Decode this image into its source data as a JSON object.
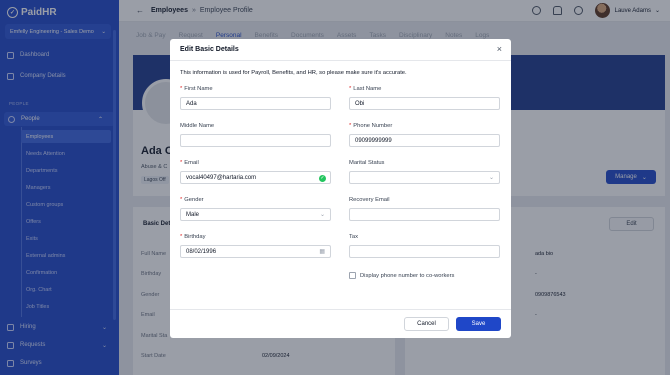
{
  "app": {
    "logo": "PaidHR",
    "org": "Emfelly Engineering - Sales Demo"
  },
  "sidebar": {
    "items": [
      {
        "label": "Dashboard"
      },
      {
        "label": "Company Details"
      }
    ],
    "section_label": "PEOPLE",
    "people_label": "People",
    "people_sub": [
      "Employees",
      "Needs Attention",
      "Departments",
      "Managers",
      "Custom groups",
      "Offers",
      "Exits",
      "External admins",
      "Confirmation",
      "Org. Chart",
      "Job Titles"
    ],
    "bottom": [
      {
        "label": "Hiring"
      },
      {
        "label": "Requests"
      },
      {
        "label": "Surveys"
      }
    ]
  },
  "topbar": {
    "breadcrumb_root": "Employees",
    "breadcrumb_current": "Employee Profile",
    "user_name": "Lauve Adams"
  },
  "tabs": [
    "Job & Pay",
    "Request",
    "Personal",
    "Benefits",
    "Documents",
    "Assets",
    "Tasks",
    "Disciplinary",
    "Notes",
    "Logs"
  ],
  "background": {
    "profile_name": "Ada O",
    "profile_sub": "Abuse & C",
    "profile_tag": "Lagos Off",
    "manage_label": "Manage",
    "details_title": "Basic Det",
    "edit_label": "Edit",
    "rows": [
      {
        "label": "Full Name",
        "right": "ada bio"
      },
      {
        "label": "Birthday",
        "right": "-"
      },
      {
        "label": "Gender",
        "right": "0909876543"
      },
      {
        "label": "Email",
        "right": "-"
      },
      {
        "label": "Marital Sta",
        "right": ""
      },
      {
        "label": "Start Date",
        "value": "02/09/2024"
      }
    ]
  },
  "modal": {
    "title": "Edit Basic Details",
    "note": "This information is used for Payroll, Benefits, and HR, so please make sure it's accurate.",
    "fields": {
      "first_name": {
        "label": "First Name",
        "value": "Ada"
      },
      "last_name": {
        "label": "Last Name",
        "value": "Obi"
      },
      "middle_name": {
        "label": "Middle Name",
        "value": ""
      },
      "phone": {
        "label": "Phone Number",
        "value": "09099999999"
      },
      "email": {
        "label": "Email",
        "value": "vocal40497@hartaria.com"
      },
      "marital": {
        "label": "Marital Status",
        "value": ""
      },
      "gender": {
        "label": "Gender",
        "value": "Male"
      },
      "recovery": {
        "label": "Recovery Email",
        "value": ""
      },
      "birthday": {
        "label": "Birthday",
        "value": "08/02/1996"
      },
      "tax": {
        "label": "Tax",
        "value": ""
      }
    },
    "checkbox_label": "Display phone number to co-workers",
    "cancel_label": "Cancel",
    "save_label": "Save"
  }
}
